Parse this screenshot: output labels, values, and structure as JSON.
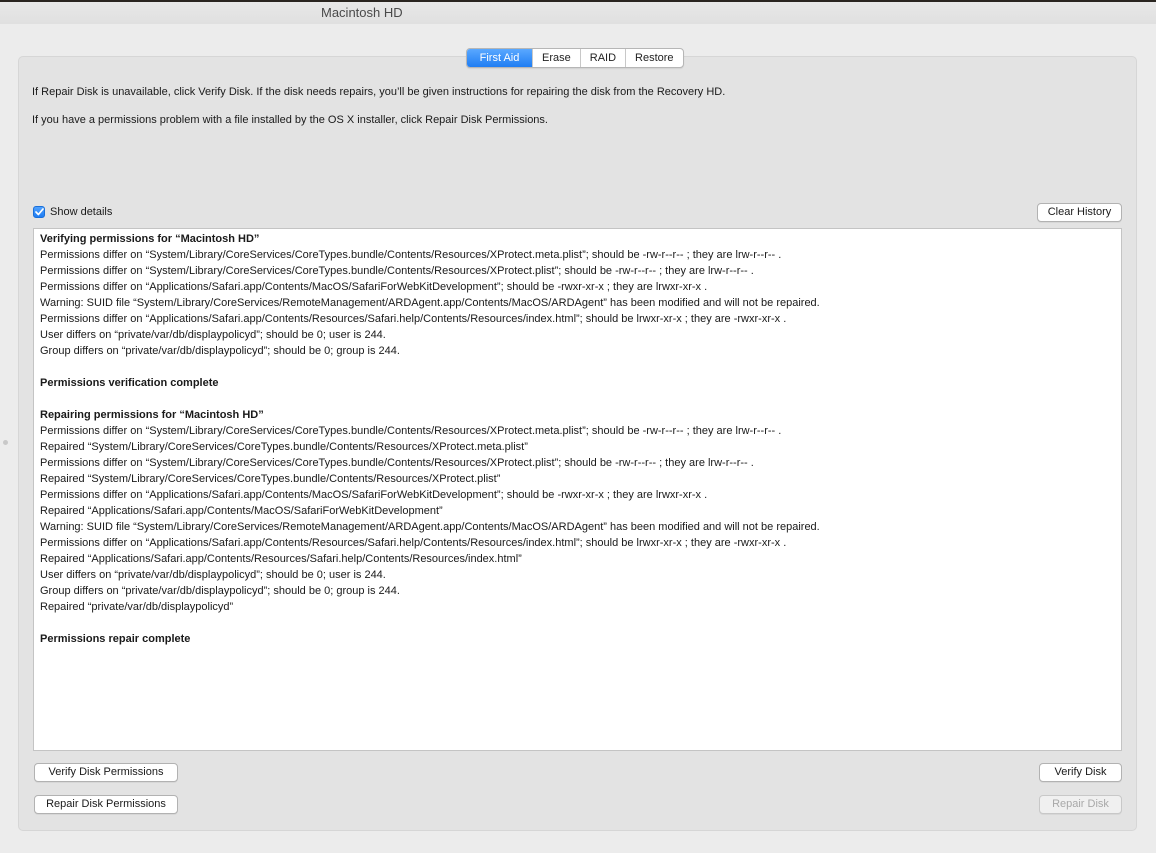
{
  "window": {
    "title": "Macintosh HD"
  },
  "tabs": [
    {
      "label": "First Aid",
      "active": true
    },
    {
      "label": "Erase",
      "active": false
    },
    {
      "label": "RAID",
      "active": false
    },
    {
      "label": "Restore",
      "active": false
    }
  ],
  "info": {
    "line1": "If Repair Disk is unavailable, click Verify Disk. If the disk needs repairs, you’ll be given instructions for repairing the disk from the Recovery HD.",
    "line2": "If you have a permissions problem with a file installed by the OS X installer, click Repair Disk Permissions."
  },
  "details": {
    "label": "Show details",
    "checked": true
  },
  "buttons": {
    "clear_history": "Clear History",
    "verify_permissions": "Verify Disk Permissions",
    "repair_permissions": "Repair Disk Permissions",
    "verify_disk": "Verify Disk",
    "repair_disk": "Repair Disk"
  },
  "log": [
    {
      "text": "Verifying permissions for “Macintosh HD”",
      "bold": true
    },
    {
      "text": "Permissions differ on “System/Library/CoreServices/CoreTypes.bundle/Contents/Resources/XProtect.meta.plist”; should be -rw-r--r-- ; they are lrw-r--r-- .",
      "bold": false
    },
    {
      "text": "Permissions differ on “System/Library/CoreServices/CoreTypes.bundle/Contents/Resources/XProtect.plist”; should be -rw-r--r-- ; they are lrw-r--r-- .",
      "bold": false
    },
    {
      "text": "Permissions differ on “Applications/Safari.app/Contents/MacOS/SafariForWebKitDevelopment”; should be -rwxr-xr-x ; they are lrwxr-xr-x .",
      "bold": false
    },
    {
      "text": "Warning: SUID file “System/Library/CoreServices/RemoteManagement/ARDAgent.app/Contents/MacOS/ARDAgent” has been modified and will not be repaired.",
      "bold": false
    },
    {
      "text": "Permissions differ on “Applications/Safari.app/Contents/Resources/Safari.help/Contents/Resources/index.html”; should be lrwxr-xr-x ; they are -rwxr-xr-x .",
      "bold": false
    },
    {
      "text": "User differs on “private/var/db/displaypolicyd”; should be 0; user is 244.",
      "bold": false
    },
    {
      "text": "Group differs on “private/var/db/displaypolicyd”; should be 0; group is 244.",
      "bold": false
    },
    {
      "text": "",
      "bold": false
    },
    {
      "text": "Permissions verification complete",
      "bold": true
    },
    {
      "text": "",
      "bold": false
    },
    {
      "text": "Repairing permissions for “Macintosh HD”",
      "bold": true
    },
    {
      "text": "Permissions differ on “System/Library/CoreServices/CoreTypes.bundle/Contents/Resources/XProtect.meta.plist”; should be -rw-r--r-- ; they are lrw-r--r-- .",
      "bold": false
    },
    {
      "text": "Repaired “System/Library/CoreServices/CoreTypes.bundle/Contents/Resources/XProtect.meta.plist”",
      "bold": false
    },
    {
      "text": "Permissions differ on “System/Library/CoreServices/CoreTypes.bundle/Contents/Resources/XProtect.plist”; should be -rw-r--r-- ; they are lrw-r--r-- .",
      "bold": false
    },
    {
      "text": "Repaired “System/Library/CoreServices/CoreTypes.bundle/Contents/Resources/XProtect.plist”",
      "bold": false
    },
    {
      "text": "Permissions differ on “Applications/Safari.app/Contents/MacOS/SafariForWebKitDevelopment”; should be -rwxr-xr-x ; they are lrwxr-xr-x .",
      "bold": false
    },
    {
      "text": "Repaired “Applications/Safari.app/Contents/MacOS/SafariForWebKitDevelopment”",
      "bold": false
    },
    {
      "text": "Warning: SUID file “System/Library/CoreServices/RemoteManagement/ARDAgent.app/Contents/MacOS/ARDAgent” has been modified and will not be repaired.",
      "bold": false
    },
    {
      "text": "Permissions differ on “Applications/Safari.app/Contents/Resources/Safari.help/Contents/Resources/index.html”; should be lrwxr-xr-x ; they are -rwxr-xr-x .",
      "bold": false
    },
    {
      "text": "Repaired “Applications/Safari.app/Contents/Resources/Safari.help/Contents/Resources/index.html”",
      "bold": false
    },
    {
      "text": "User differs on “private/var/db/displaypolicyd”; should be 0; user is 244.",
      "bold": false
    },
    {
      "text": "Group differs on “private/var/db/displaypolicyd”; should be 0; group is 244.",
      "bold": false
    },
    {
      "text": "Repaired “private/var/db/displaypolicyd”",
      "bold": false
    },
    {
      "text": "",
      "bold": false
    },
    {
      "text": "Permissions repair complete",
      "bold": true
    }
  ],
  "colors": {
    "accent": "#1f7df3",
    "window_bg": "#ececec",
    "panel_bg": "#e3e3e3"
  }
}
